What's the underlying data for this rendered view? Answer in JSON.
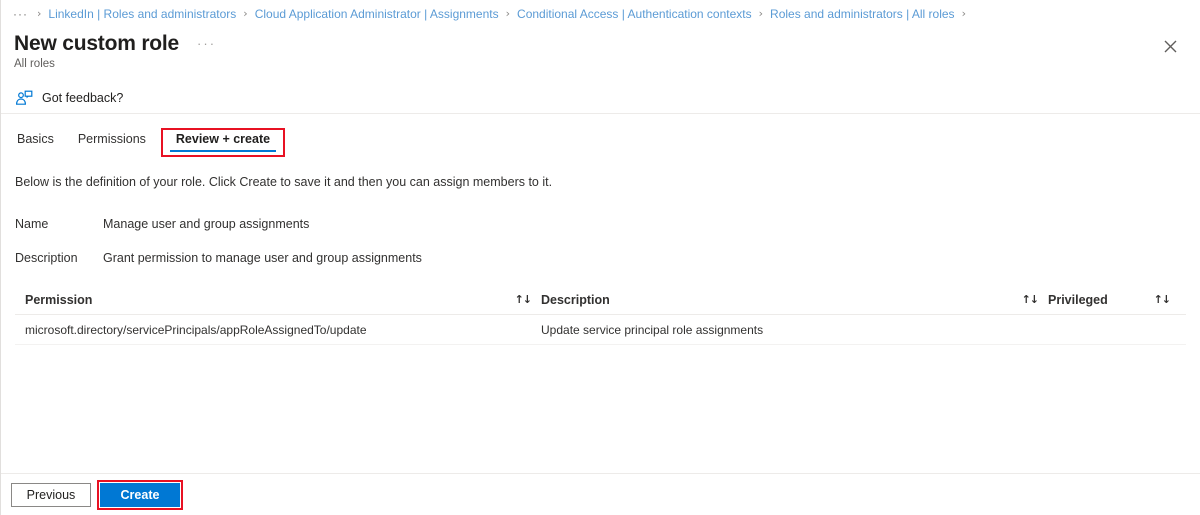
{
  "breadcrumb": {
    "overflow": "···",
    "separator": "›",
    "items": [
      "LinkedIn | Roles and administrators",
      "Cloud Application Administrator | Assignments",
      "Conditional Access | Authentication contexts",
      "Roles and administrators | All roles"
    ]
  },
  "header": {
    "title": "New custom role",
    "ellipsis": "···",
    "subtitle": "All roles",
    "close_label": "Close"
  },
  "feedback": {
    "label": "Got feedback?",
    "icon": "feedback-person-icon"
  },
  "tabs": [
    {
      "label": "Basics",
      "active": false
    },
    {
      "label": "Permissions",
      "active": false
    },
    {
      "label": "Review + create",
      "active": true,
      "highlight": true
    }
  ],
  "main": {
    "intro": "Below is the definition of your role. Click Create to save it and then you can assign members to it.",
    "fields": [
      {
        "label": "Name",
        "value": "Manage user and group assignments"
      },
      {
        "label": "Description",
        "value": "Grant permission to manage user and group assignments"
      }
    ],
    "table": {
      "sort_icon": "↑↓",
      "columns": [
        {
          "key": "permission",
          "label": "Permission"
        },
        {
          "key": "description",
          "label": "Description"
        },
        {
          "key": "privileged",
          "label": "Privileged"
        }
      ],
      "rows": [
        {
          "permission": "microsoft.directory/servicePrincipals/appRoleAssignedTo/update",
          "description": "Update service principal role assignments",
          "privileged": ""
        }
      ]
    }
  },
  "footer": {
    "previous_label": "Previous",
    "create_label": "Create"
  },
  "colors": {
    "accent": "#0078d4",
    "link": "#5b9bd5",
    "highlight": "#e81123",
    "text": "#323130",
    "divider": "#edebe9"
  }
}
